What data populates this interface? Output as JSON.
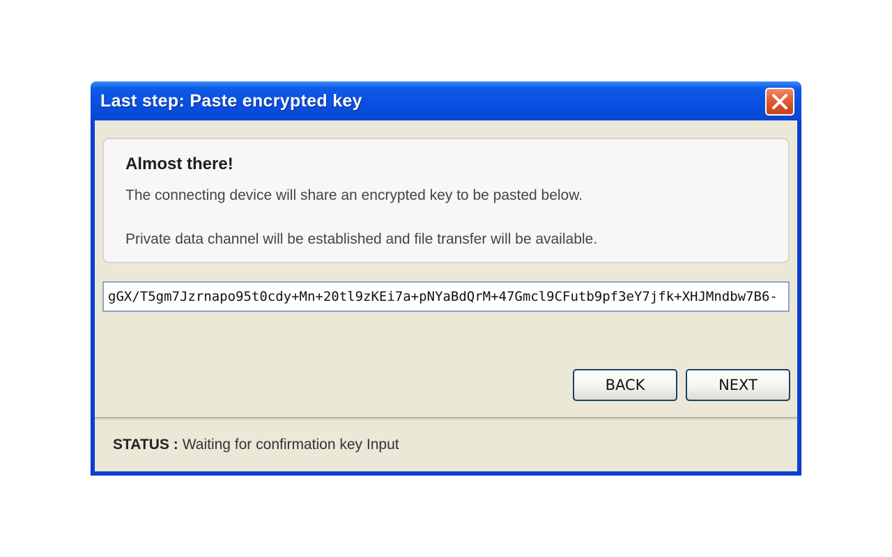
{
  "window": {
    "title": "Last step: Paste encrypted key"
  },
  "info": {
    "heading": "Almost there!",
    "line1": "The connecting device will share an encrypted key to be pasted below.",
    "line2": "Private data channel will be established and file transfer will be available."
  },
  "key_field": {
    "value": "gGX/T5gm7Jzrnapo95t0cdy+Mn+20tl9zKEi7a+pNYaBdQrM+47Gmcl9CFutb9pf3eY7jfk+XHJMndbw7B6-"
  },
  "buttons": {
    "back": "BACK",
    "next": "NEXT"
  },
  "status": {
    "label": "STATUS :",
    "text": "Waiting for confirmation key Input"
  },
  "icons": {
    "close": "close-icon"
  },
  "colors": {
    "titlebar": "#0a4fe0",
    "close_button": "#e05a32",
    "client_background": "#ebe8d8",
    "panel_background": "#f7f7f7"
  }
}
